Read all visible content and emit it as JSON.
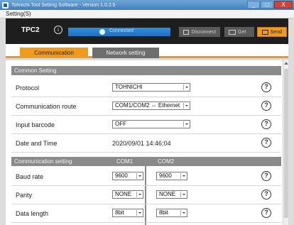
{
  "window": {
    "title": "Tohnichi Tool Setting Software - Version 1.0.2.5",
    "buttons": {
      "minimize": "_",
      "maximize": "□",
      "close": "X"
    }
  },
  "menubar": {
    "settings": "Setting(S)"
  },
  "toolbar": {
    "device": "TPC2",
    "info_icon": "i",
    "connection_status": "Connected",
    "disconnect_label": "Disconnect",
    "get_label": "Get",
    "send_label": "Send"
  },
  "tabs": {
    "communication": "Communication",
    "network": "Network setting"
  },
  "common": {
    "header": "Common Setting",
    "protocol": {
      "label": "Protocol",
      "value": "TOHNICHI"
    },
    "route": {
      "label": "Communication route",
      "value": "COM1/COM2 ⇔ Ethernet"
    },
    "barcode": {
      "label": "Input barcode",
      "value": "OFF"
    },
    "datetime": {
      "label": "Date and Time",
      "value": "2020/09/01 14:46:04"
    }
  },
  "comm": {
    "header": "Communication setting",
    "com1": "COM1",
    "com2": "COM2",
    "baud": {
      "label": "Baud rate",
      "com1": "9600",
      "com2": "9600"
    },
    "parity": {
      "label": "Parity",
      "com1": "NONE",
      "com2": "NONE"
    },
    "length": {
      "label": "Data length",
      "com1": "8bit",
      "com2": "8bit"
    }
  },
  "help_glyph": "?",
  "colors": {
    "accent": "#f19a1c",
    "toolbar": "#1e1e1e",
    "connected": "#2f8ede",
    "section_header": "#8a8a8a"
  }
}
